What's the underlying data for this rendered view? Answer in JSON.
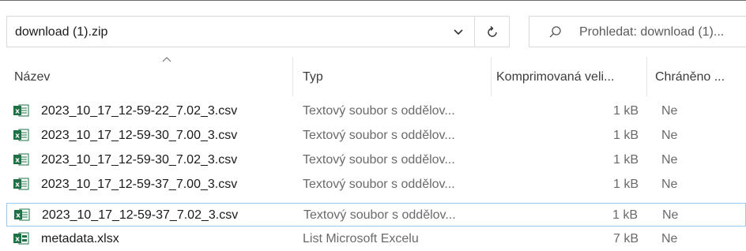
{
  "address_bar": {
    "path": "download (1).zip"
  },
  "search": {
    "placeholder": "Prohledat: download (1)..."
  },
  "columns": {
    "name": "Název",
    "type": "Typ",
    "compressed": "Komprimovaná veli...",
    "protected": "Chráněno ..."
  },
  "files": [
    {
      "name": "2023_10_17_12-59-22_7.02_3.csv",
      "type": "Textový soubor s oddělov...",
      "size": "1 kB",
      "protected": "Ne",
      "icon": "excel-csv-icon"
    },
    {
      "name": "2023_10_17_12-59-30_7.00_3.csv",
      "type": "Textový soubor s oddělov...",
      "size": "1 kB",
      "protected": "Ne",
      "icon": "excel-csv-icon"
    },
    {
      "name": "2023_10_17_12-59-30_7.02_3.csv",
      "type": "Textový soubor s oddělov...",
      "size": "1 kB",
      "protected": "Ne",
      "icon": "excel-csv-icon"
    },
    {
      "name": "2023_10_17_12-59-37_7.00_3.csv",
      "type": "Textový soubor s oddělov...",
      "size": "1 kB",
      "protected": "Ne",
      "icon": "excel-csv-icon"
    },
    {
      "name": "2023_10_17_12-59-37_7.02_3.csv",
      "type": "Textový soubor s oddělov...",
      "size": "1 kB",
      "protected": "Ne",
      "icon": "excel-csv-icon",
      "focused": true
    },
    {
      "name": "metadata.xlsx",
      "type": "List Microsoft Excelu",
      "size": "7 kB",
      "protected": "Ne",
      "icon": "excel-xlsx-icon"
    }
  ],
  "colors": {
    "excel_green": "#1e7145",
    "focus_border": "#99c9ef"
  }
}
